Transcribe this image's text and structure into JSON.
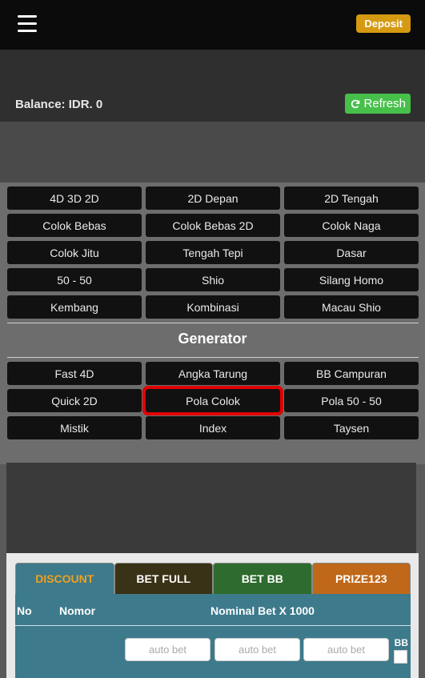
{
  "header": {
    "deposit_label": "Deposit"
  },
  "balance": {
    "text": "Balance: IDR. 0",
    "refresh_label": "Refresh"
  },
  "menu": {
    "rows": [
      [
        "4D 3D 2D",
        "2D Depan",
        "2D Tengah"
      ],
      [
        "Colok Bebas",
        "Colok Bebas 2D",
        "Colok Naga"
      ],
      [
        "Colok Jitu",
        "Tengah Tepi",
        "Dasar"
      ],
      [
        "50 - 50",
        "Shio",
        "Silang Homo"
      ],
      [
        "Kembang",
        "Kombinasi",
        "Macau Shio"
      ]
    ]
  },
  "generator": {
    "title": "Generator",
    "rows": [
      [
        "Fast 4D",
        "Angka Tarung",
        "BB Campuran"
      ],
      [
        "Quick 2D",
        "Pola Colok",
        "Pola 50 - 50"
      ],
      [
        "Mistik",
        "Index",
        "Taysen"
      ]
    ]
  },
  "tabs": [
    {
      "label": "DISCOUNT",
      "bg": "#3d7a8c",
      "fg": "#f0a020"
    },
    {
      "label": "BET FULL",
      "bg": "#3a3216",
      "fg": "#ffffff"
    },
    {
      "label": "BET BB",
      "bg": "#2e6b2e",
      "fg": "#ffffff"
    },
    {
      "label": "PRIZE123",
      "bg": "#c0681a",
      "fg": "#ffffff"
    }
  ],
  "table": {
    "col_no": "No",
    "col_nomor": "Nomor",
    "col_nominal": "Nominal Bet X 1000",
    "placeholder": "auto bet",
    "bb_label": "BB"
  },
  "colors": {
    "deposit": "#d59a12",
    "refresh": "#46c04a",
    "highlight": "#e00000"
  }
}
